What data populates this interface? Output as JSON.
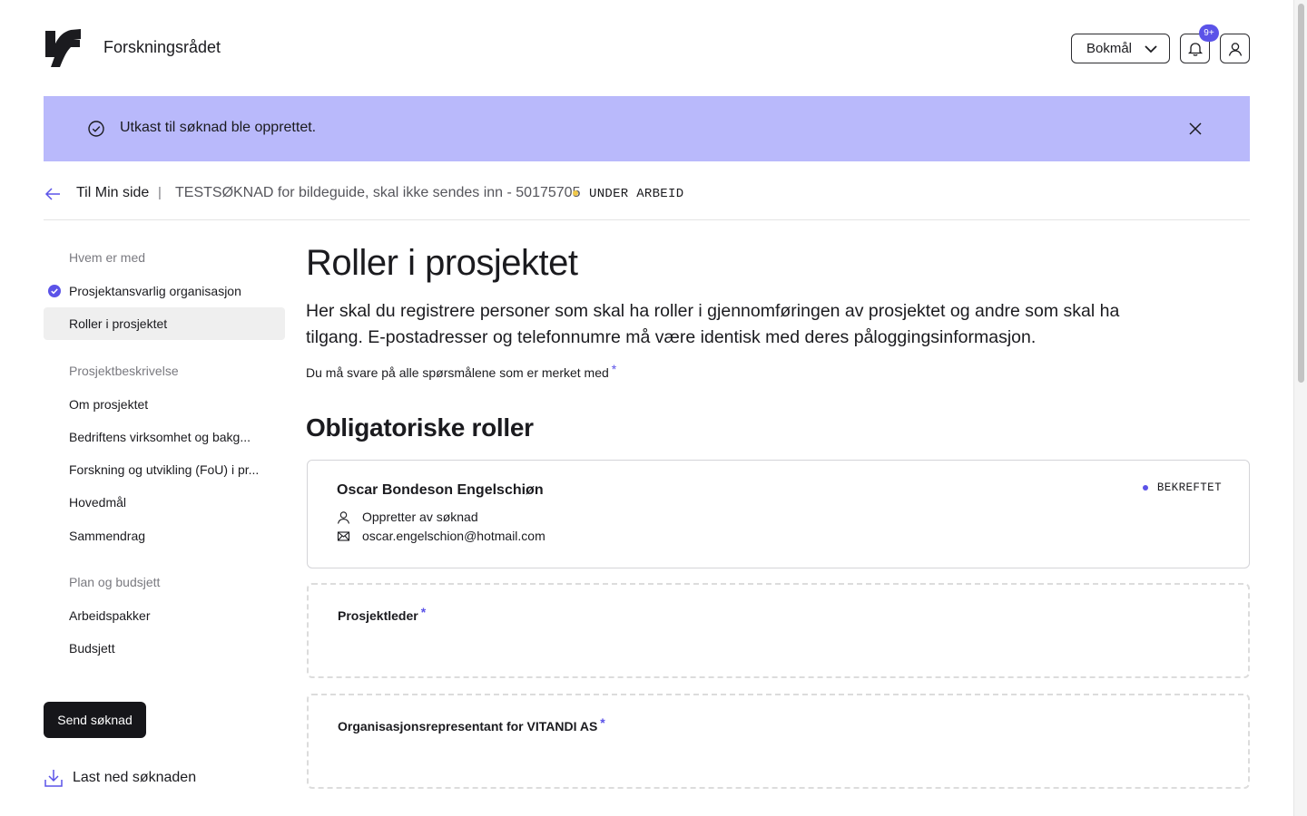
{
  "header": {
    "brand": "Forskningsrådet",
    "language": "Bokmål",
    "notification_badge": "9+"
  },
  "alert": {
    "message": "Utkast til søknad ble opprettet."
  },
  "breadcrumb": {
    "back_label": "Til Min side",
    "separator": "|",
    "application_title": "TESTSØKNAD for bildeguide, skal ikke sendes inn - 50175705",
    "status": "UNDER ARBEID",
    "status_color": "#f0c84a"
  },
  "sidebar": {
    "sections": [
      {
        "title": "Hvem er med",
        "items": [
          {
            "label": "Prosjektansvarlig organisasjon",
            "completed": true
          },
          {
            "label": "Roller i prosjektet",
            "active": true
          }
        ]
      },
      {
        "title": "Prosjektbeskrivelse",
        "items": [
          {
            "label": "Om prosjektet"
          },
          {
            "label": "Bedriftens virksomhet og bakg..."
          },
          {
            "label": "Forskning og utvikling (FoU) i pr..."
          },
          {
            "label": "Hovedmål"
          },
          {
            "label": "Sammendrag"
          }
        ]
      },
      {
        "title": "Plan og budsjett",
        "items": [
          {
            "label": "Arbeidspakker"
          },
          {
            "label": "Budsjett"
          }
        ]
      }
    ],
    "send_button": "Send søknad",
    "download_label": "Last ned søknaden"
  },
  "main": {
    "title": "Roller i prosjektet",
    "lead": "Her skal du registrere personer som skal ha roller i gjennomføringen av prosjektet og andre som skal ha tilgang. E-postadresser og telefonnumre må være identisk med deres påloggingsinformasjon.",
    "required_note": "Du må svare på alle spørsmålene som er merket med",
    "required_marker": "*",
    "section_title": "Obligatoriske roller",
    "confirmed_person": {
      "name": "Oscar Bondeson Engelschiøn",
      "status": "BEKREFTET",
      "role": "Oppretter av søknad",
      "email": "oscar.engelschion@hotmail.com"
    },
    "open_roles": [
      {
        "label": "Prosjektleder",
        "marker": "*"
      },
      {
        "label": "Organisasjonsrepresentant for VITANDI AS",
        "marker": "*"
      }
    ]
  },
  "colors": {
    "accent": "#5b53e8",
    "alert_background": "#b9b9fb"
  }
}
